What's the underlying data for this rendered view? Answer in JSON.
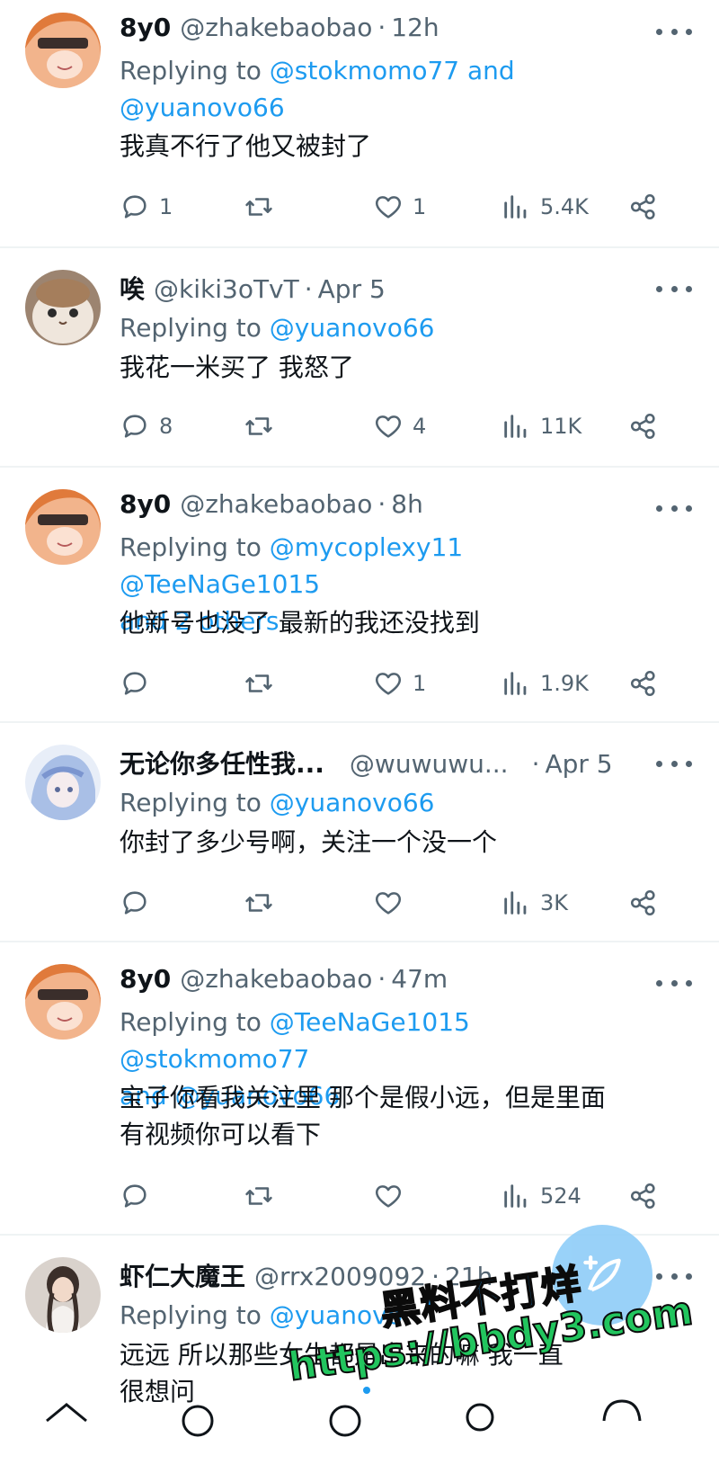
{
  "tweets": [
    {
      "name": "8y0",
      "handle": "@zhakebaobao",
      "time": "12h",
      "replying_prefix": "Replying to ",
      "replying_targets": "@stokmomo77 and",
      "replying_line2": "@yuanovo66",
      "text_lines": [
        "我真不行了他又被封了"
      ],
      "replies": "1",
      "retweets": "",
      "likes": "1",
      "views": "5.4K"
    },
    {
      "name": "唉",
      "handle": "@kiki3oTvT",
      "time": "Apr 5",
      "replying_prefix": "Replying to ",
      "replying_targets": "@yuanovo66",
      "replying_line2": "",
      "text_lines": [
        "我花一米买了 我怒了"
      ],
      "replies": "8",
      "retweets": "",
      "likes": "4",
      "views": "11K"
    },
    {
      "name": "8y0",
      "handle": "@zhakebaobao",
      "time": "8h",
      "replying_prefix": "Replying to ",
      "replying_targets": "@mycoplexy11 @TeeNaGe1015",
      "replying_line2": "and 2 others",
      "text_lines": [
        "他新号也没了 最新的我还没找到"
      ],
      "replies": "",
      "retweets": "",
      "likes": "1",
      "views": "1.9K"
    },
    {
      "name": "无论你多任性我...",
      "handle": "@wuwuwu...",
      "time": "Apr 5",
      "replying_prefix": "Replying to ",
      "replying_targets": "@yuanovo66",
      "replying_line2": "",
      "text_lines": [
        "你封了多少号啊，关注一个没一个"
      ],
      "replies": "",
      "retweets": "",
      "likes": "",
      "views": "3K"
    },
    {
      "name": "8y0",
      "handle": "@zhakebaobao",
      "time": "47m",
      "replying_prefix": "Replying to ",
      "replying_targets": "@TeeNaGe1015 @stokmomo77",
      "replying_line2": "and @yuanovo66",
      "text_lines": [
        "宝子你看我关注里 那个是假小远，但是里面",
        "有视频你可以看下"
      ],
      "replies": "",
      "retweets": "",
      "likes": "",
      "views": "524"
    },
    {
      "name": "虾仁大魔王",
      "handle": "@rrx2009092",
      "time": "21h",
      "replying_prefix": "Replying to ",
      "replying_targets": "@yuanovo",
      "replying_line2": "",
      "text_lines": [
        "远远 所以那些女生都是出来的嘛 我一直",
        "很想问"
      ],
      "replies": "",
      "retweets": "",
      "likes": "",
      "views": ""
    }
  ],
  "watermark": {
    "line1": "黑料不打烊",
    "line2": "https://bbdy3.com"
  },
  "icons": {
    "reply": "reply-icon",
    "retweet": "retweet-icon",
    "like": "heart-icon",
    "views": "views-icon",
    "share": "share-icon",
    "more": "more-icon",
    "compose": "compose-icon"
  },
  "colors": {
    "accent": "#1d9bf0",
    "muted": "#536471",
    "text": "#0f1419",
    "separator": "#eff3f4"
  }
}
